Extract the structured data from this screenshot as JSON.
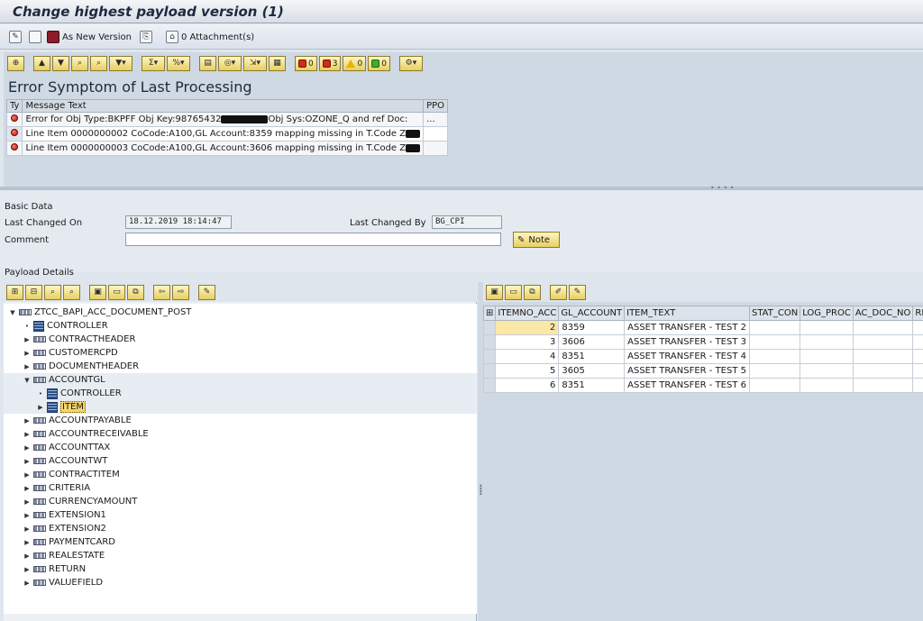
{
  "window": {
    "title": "Change highest payload version (1)"
  },
  "app_toolbar": {
    "as_new_version": "As New Version",
    "attachments": "0 Attachment(s)"
  },
  "status_counts": {
    "stop": "0",
    "error": "3",
    "warning": "0",
    "success": "0"
  },
  "error_section": {
    "title": "Error Symptom of Last Processing",
    "columns": {
      "ty": "Ty",
      "message": "Message Text",
      "ppo": "PPO"
    },
    "rows": [
      {
        "pre": "Error for Obj Type:BKPFF Obj Key:98765432",
        "post": "Obj Sys:OZONE_Q and ref Doc:",
        "ppo": "..."
      },
      {
        "pre": "Line Item 0000000002 CoCode:A100,GL Account:8359 mapping missing in T.Code Z",
        "post": "",
        "ppo": ""
      },
      {
        "pre": "Line Item 0000000003 CoCode:A100,GL Account:3606 mapping missing in T.Code Z",
        "post": "",
        "ppo": ""
      }
    ]
  },
  "basic_data": {
    "section_label": "Basic Data",
    "last_changed_on_label": "Last Changed On",
    "last_changed_on_value": "18.12.2019 18:14:47",
    "last_changed_by_label": "Last Changed By",
    "last_changed_by_value": "BG_CPI",
    "comment_label": "Comment",
    "comment_value": "",
    "note_button": "Note"
  },
  "payload_details": {
    "label": "Payload Details",
    "tree": [
      {
        "label": "ZTCC_BAPI_ACC_DOCUMENT_POST",
        "level": 0,
        "icon": "structure",
        "expanded": true
      },
      {
        "label": "CONTROLLER",
        "level": 1,
        "icon": "table"
      },
      {
        "label": "CONTRACTHEADER",
        "level": 1,
        "icon": "structure"
      },
      {
        "label": "CUSTOMERCPD",
        "level": 1,
        "icon": "structure"
      },
      {
        "label": "DOCUMENTHEADER",
        "level": 1,
        "icon": "structure"
      },
      {
        "label": "ACCOUNTGL",
        "level": 1,
        "icon": "structure",
        "expanded": true
      },
      {
        "label": "CONTROLLER",
        "level": 2,
        "icon": "table"
      },
      {
        "label": "ITEM",
        "level": 2,
        "icon": "table",
        "selected": true
      },
      {
        "label": "ACCOUNTPAYABLE",
        "level": 1,
        "icon": "structure"
      },
      {
        "label": "ACCOUNTRECEIVABLE",
        "level": 1,
        "icon": "structure"
      },
      {
        "label": "ACCOUNTTAX",
        "level": 1,
        "icon": "structure"
      },
      {
        "label": "ACCOUNTWT",
        "level": 1,
        "icon": "structure"
      },
      {
        "label": "CONTRACTITEM",
        "level": 1,
        "icon": "structure"
      },
      {
        "label": "CRITERIA",
        "level": 1,
        "icon": "structure"
      },
      {
        "label": "CURRENCYAMOUNT",
        "level": 1,
        "icon": "structure"
      },
      {
        "label": "EXTENSION1",
        "level": 1,
        "icon": "structure"
      },
      {
        "label": "EXTENSION2",
        "level": 1,
        "icon": "structure"
      },
      {
        "label": "PAYMENTCARD",
        "level": 1,
        "icon": "structure"
      },
      {
        "label": "REALESTATE",
        "level": 1,
        "icon": "structure"
      },
      {
        "label": "RETURN",
        "level": 1,
        "icon": "structure"
      },
      {
        "label": "VALUEFIELD",
        "level": 1,
        "icon": "structure"
      }
    ]
  },
  "item_grid": {
    "columns": [
      "ITEMNO_ACC",
      "GL_ACCOUNT",
      "ITEM_TEXT",
      "STAT_CON",
      "LOG_PROC",
      "AC_DOC_NO",
      "REF_K"
    ],
    "rows": [
      {
        "itemno": "2",
        "gl": "8359",
        "text": "ASSET TRANSFER - TEST 2"
      },
      {
        "itemno": "3",
        "gl": "3606",
        "text": "ASSET TRANSFER - TEST 3"
      },
      {
        "itemno": "4",
        "gl": "8351",
        "text": "ASSET TRANSFER - TEST 4"
      },
      {
        "itemno": "5",
        "gl": "3605",
        "text": "ASSET TRANSFER - TEST 5"
      },
      {
        "itemno": "6",
        "gl": "8351",
        "text": "ASSET TRANSFER - TEST 6"
      }
    ]
  }
}
